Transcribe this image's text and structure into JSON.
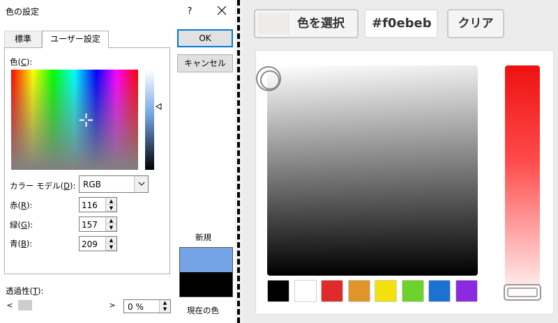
{
  "dialog": {
    "title": "色の設定",
    "help_label": "?",
    "tabs": [
      {
        "label": "標準"
      },
      {
        "label": "ユーザー設定"
      }
    ],
    "color_label": "色(C):",
    "color_label_pre": "色(",
    "color_label_key": "C",
    "color_label_post": "):",
    "model_label_pre": "カラー モデル(",
    "model_label_key": "D",
    "model_label_post": "):",
    "model_value": "RGB",
    "red_label_pre": "赤(",
    "red_label_key": "R",
    "red_label_post": "):",
    "red_value": "116",
    "green_label_pre": "緑(",
    "green_label_key": "G",
    "green_label_post": "):",
    "green_value": "157",
    "blue_label_pre": "青(",
    "blue_label_key": "B",
    "blue_label_post": "):",
    "blue_value": "209",
    "ok_label": "OK",
    "cancel_label": "キャンセル",
    "new_label": "新規",
    "current_label": "現在の色",
    "transparency_label_pre": "透過性(",
    "transparency_label_key": "T",
    "transparency_label_post": "):",
    "transparency_value": "0 %",
    "colors": {
      "new_color": "#74a4e6",
      "current_color": "#000000",
      "ok_border": "#0078d7"
    }
  },
  "picker": {
    "select_label": "色を選択",
    "hex_value": "#f0ebeb",
    "clear_label": "クリア",
    "selected_color": "#f0ebeb",
    "swatches": [
      {
        "name": "black",
        "color": "#000000"
      },
      {
        "name": "white",
        "color": "#ffffff"
      },
      {
        "name": "red",
        "color": "#e02b2b"
      },
      {
        "name": "orange",
        "color": "#e0952b"
      },
      {
        "name": "yellow",
        "color": "#f2e10c"
      },
      {
        "name": "green",
        "color": "#6fd12b"
      },
      {
        "name": "blue",
        "color": "#1c72d0"
      },
      {
        "name": "purple",
        "color": "#8b2ae0"
      }
    ]
  }
}
